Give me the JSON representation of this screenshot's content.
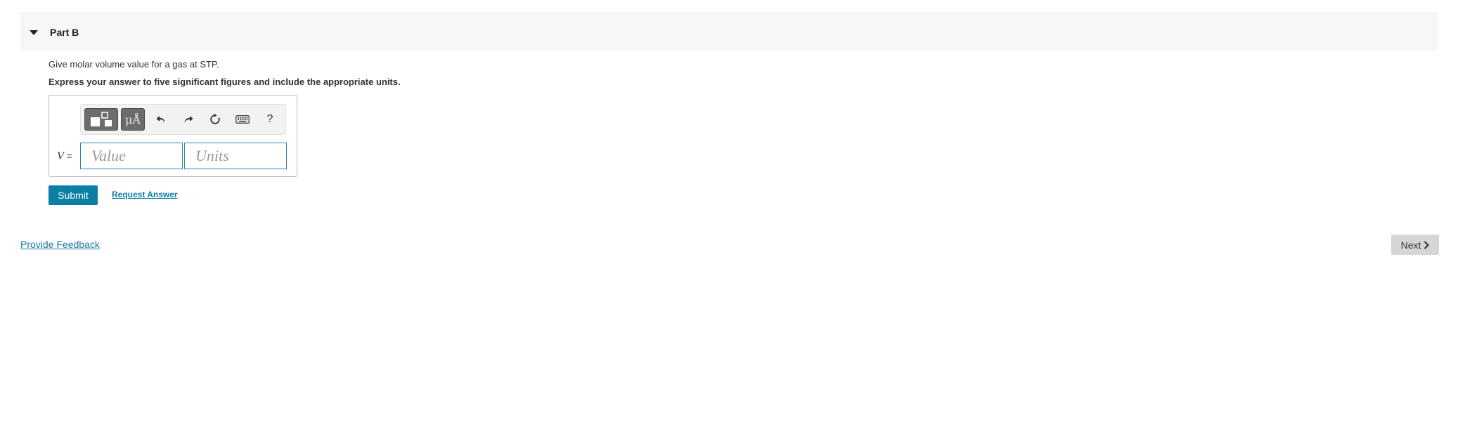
{
  "part": {
    "title": "Part B",
    "question": "Give molar volume value for a gas at STP.",
    "instruction": "Express your answer to five significant figures and include the appropriate units."
  },
  "answer": {
    "variable": "V",
    "equals": "=",
    "value_placeholder": "Value",
    "units_placeholder": "Units",
    "toolbar": {
      "templates_icon": "templates-icon",
      "units_label": "μÅ",
      "undo_icon": "undo-icon",
      "redo_icon": "redo-icon",
      "reset_icon": "reset-icon",
      "keyboard_icon": "keyboard-icon",
      "help_label": "?"
    }
  },
  "actions": {
    "submit_label": "Submit",
    "request_answer_label": "Request Answer"
  },
  "footer": {
    "feedback_label": "Provide Feedback",
    "next_label": "Next"
  },
  "colors": {
    "accent": "#0a7ea4",
    "input_border": "#2f85a8",
    "header_bg": "#f7f7f7",
    "next_bg": "#d6d6d6"
  }
}
